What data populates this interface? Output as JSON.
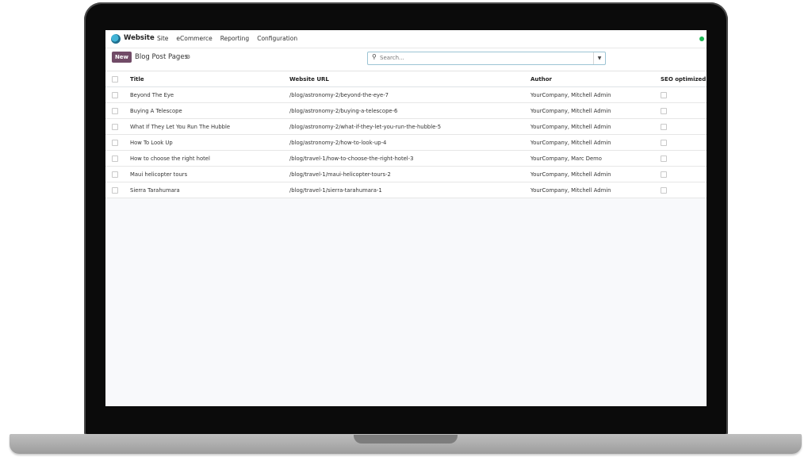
{
  "app": {
    "name": "Website",
    "menu": [
      "Site",
      "eCommerce",
      "Reporting",
      "Configuration"
    ]
  },
  "control_panel": {
    "new_label": "New",
    "title": "Blog Post Pages",
    "search_placeholder": "Search..."
  },
  "table": {
    "headers": {
      "title": "Title",
      "url": "Website URL",
      "author": "Author",
      "seo": "SEO optimized"
    },
    "rows": [
      {
        "title": "Beyond The Eye",
        "url": "/blog/astronomy-2/beyond-the-eye-7",
        "author": "YourCompany, Mitchell Admin",
        "seo": false
      },
      {
        "title": "Buying A Telescope",
        "url": "/blog/astronomy-2/buying-a-telescope-6",
        "author": "YourCompany, Mitchell Admin",
        "seo": false
      },
      {
        "title": "What If They Let You Run The Hubble",
        "url": "/blog/astronomy-2/what-if-they-let-you-run-the-hubble-5",
        "author": "YourCompany, Mitchell Admin",
        "seo": false
      },
      {
        "title": "How To Look Up",
        "url": "/blog/astronomy-2/how-to-look-up-4",
        "author": "YourCompany, Mitchell Admin",
        "seo": false
      },
      {
        "title": "How to choose the right hotel",
        "url": "/blog/travel-1/how-to-choose-the-right-hotel-3",
        "author": "YourCompany, Marc Demo",
        "seo": false
      },
      {
        "title": "Maui helicopter tours",
        "url": "/blog/travel-1/maui-helicopter-tours-2",
        "author": "YourCompany, Mitchell Admin",
        "seo": false
      },
      {
        "title": "Sierra Tarahumara",
        "url": "/blog/travel-1/sierra-tarahumara-1",
        "author": "YourCompany, Mitchell Admin",
        "seo": false
      }
    ]
  },
  "colors": {
    "primary": "#714b67",
    "status": "#1db954"
  }
}
